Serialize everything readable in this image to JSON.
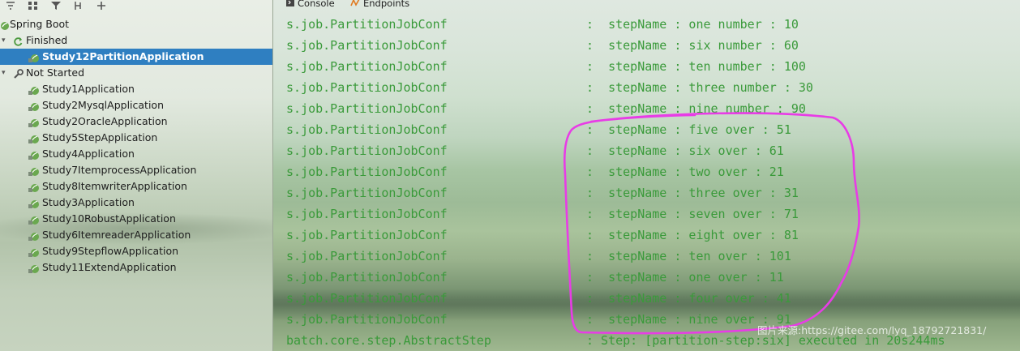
{
  "left_panel": {
    "toolbar": {
      "icons": [
        "collapse-all-icon",
        "group-icon",
        "filter-icon",
        "add-config-icon",
        "add-icon"
      ]
    },
    "tree": {
      "root": "Spring Boot",
      "finished_group": "Finished",
      "finished_items": [
        "Study12PartitionApplication"
      ],
      "not_started_group": "Not Started",
      "not_started_items": [
        "Study1Application",
        "Study2MysqlApplication",
        "Study2OracleApplication",
        "Study5StepApplication",
        "Study4Application",
        "Study7ItemprocessApplication",
        "Study8ItemwriterApplication",
        "Study3Application",
        "Study10RobustApplication",
        "Study6ItemreaderApplication",
        "Study9StepflowApplication",
        "Study11ExtendApplication"
      ]
    }
  },
  "right_panel": {
    "tabs": {
      "console": "Console",
      "endpoints": "Endpoints"
    },
    "log_lines": [
      {
        "source": "s.job.PartitionJobConf",
        "message": ":  stepName : one number : 10"
      },
      {
        "source": "s.job.PartitionJobConf",
        "message": ":  stepName : six number : 60"
      },
      {
        "source": "s.job.PartitionJobConf",
        "message": ":  stepName : ten number : 100"
      },
      {
        "source": "s.job.PartitionJobConf",
        "message": ":  stepName : three number : 30"
      },
      {
        "source": "s.job.PartitionJobConf",
        "message": ":  stepName : nine number : 90"
      },
      {
        "source": "s.job.PartitionJobConf",
        "message": ":  stepName : five over : 51"
      },
      {
        "source": "s.job.PartitionJobConf",
        "message": ":  stepName : six over : 61"
      },
      {
        "source": "s.job.PartitionJobConf",
        "message": ":  stepName : two over : 21"
      },
      {
        "source": "s.job.PartitionJobConf",
        "message": ":  stepName : three over : 31"
      },
      {
        "source": "s.job.PartitionJobConf",
        "message": ":  stepName : seven over : 71"
      },
      {
        "source": "s.job.PartitionJobConf",
        "message": ":  stepName : eight over : 81"
      },
      {
        "source": "s.job.PartitionJobConf",
        "message": ":  stepName : ten over : 101"
      },
      {
        "source": "s.job.PartitionJobConf",
        "message": ":  stepName : one over : 11"
      },
      {
        "source": "s.job.PartitionJobConf",
        "message": ":  stepName : four over : 41"
      },
      {
        "source": "s.job.PartitionJobConf",
        "message": ":  stepName : nine over : 91"
      },
      {
        "source": "batch.core.step.AbstractStep",
        "message": ": Step: [partition-step:six] executed in 20s244ms"
      }
    ],
    "watermark": "图片来源:https://gitee.com/lyq_18792721831/",
    "annotation_color": "#e83ce6"
  },
  "colors": {
    "log_text": "#3a9a3a",
    "selection": "#2f7fc1"
  }
}
